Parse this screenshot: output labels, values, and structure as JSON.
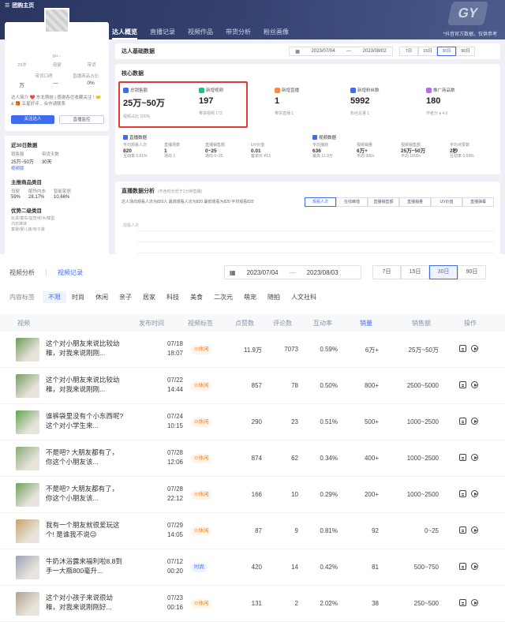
{
  "header": {
    "brand": "团购主页",
    "tabs": [
      "达人概览",
      "直播记录",
      "视频作品",
      "带货分析",
      "粉丝画像"
    ],
    "right_text": "*抖音官方数据，仅供参考",
    "deco": "GY"
  },
  "profile": {
    "name": "gu...",
    "stats_labels": [
      "29岁",
      "母婴",
      "带货"
    ],
    "meta_labels": [
      "带货口碑",
      "直播商品占比"
    ],
    "meta_values": [
      "万",
      "—",
      "0%"
    ],
    "desc": "达人简介 ❤️ 东北萌娃 | 感谢各位收藏关注 ! 🤝 & 🎁 五星好评... 合作请联系",
    "btn_follow": "关注达人",
    "btn_monitor": "直播监控"
  },
  "left30": {
    "title": "近30日数据",
    "labels": [
      "销售额",
      "带货天数"
    ],
    "values": [
      "25万~50万",
      "30天"
    ],
    "link": "视频版",
    "main_cat_title": "主推商品类目",
    "main_cats": [
      "母婴",
      "服饰内衣",
      "智能家居"
    ],
    "main_pcts": [
      "59%",
      "28.17%",
      "10.66%"
    ],
    "good_title": "优势二级类目",
    "good_lines": [
      "玩具/童车/益智/积木/模型",
      "内衣裤袜",
      "童装/婴儿装/亲子装"
    ]
  },
  "basic": {
    "title": "达人基础数据",
    "date_from": "2023/07/04",
    "date_to": "2023/08/02",
    "ranges": [
      "7日",
      "15日",
      "30日",
      "90日"
    ],
    "range_active": 2
  },
  "core": {
    "title": "核心数据",
    "kpis": [
      {
        "label": "总销售额",
        "value": "25万~50万",
        "sub": "视频占比 100%",
        "color": "#3e6cf0"
      },
      {
        "label": "新增视频",
        "value": "197",
        "sub": "带货视频 172",
        "color": "#1ebd8c"
      },
      {
        "label": "新增直播",
        "value": "1",
        "sub": "带货直播 1",
        "color": "#ff8a3d"
      },
      {
        "label": "新增粉丝数",
        "value": "5992",
        "sub": "粉丝总量 1",
        "color": "#3e6cf0"
      },
      {
        "label": "推广商品数",
        "value": "180",
        "sub": "作者分 ♦ 4.6",
        "color": "#b36bf0"
      }
    ],
    "live_title": "直播数据",
    "video_title": "视频数据",
    "live_minis": [
      {
        "l": "平均观看人次",
        "v": "820",
        "s": "互动率 0.61%"
      },
      {
        "l": "直播场数",
        "v": "1",
        "s": "场均 1"
      },
      {
        "l": "直播销售额",
        "v": "0~25",
        "s": "场均 0~25"
      },
      {
        "l": "UV价值",
        "v": "0.01",
        "s": "客单价 ¥13"
      }
    ],
    "video_minis": [
      {
        "l": "平均播放",
        "v": "636",
        "s": "最高 11.9万"
      },
      {
        "l": "视频销量",
        "v": "6万+",
        "s": "平均 300+"
      },
      {
        "l": "视频销售额",
        "v": "25万~50万",
        "s": "平均 1000+"
      },
      {
        "l": "平均点赞数",
        "v": "2秒",
        "s": "互动率 0.59%"
      }
    ]
  },
  "live": {
    "title": "直播数据分析",
    "subtitle": "(不含时长低于1分钟直播)",
    "summary": "达人场均观看人次为820人  最高观看人次为820  最低观看为820  平均观看820",
    "tabs": [
      "观看人次",
      "在线峰值",
      "直播销售额",
      "直播销量",
      "UV价值",
      "直播弹幕"
    ],
    "tab_active": 0,
    "y_label": "观看人次"
  },
  "video": {
    "tabs": [
      "视频分析",
      "视频记录"
    ],
    "tab_active": 1,
    "date_from": "2023/07/04",
    "date_sep": "—",
    "date_to": "2023/08/03",
    "ranges": [
      "7日",
      "15日",
      "30日",
      "90日"
    ],
    "range_active": 2,
    "cat_label": "内容标签",
    "cats": [
      "不限",
      "时尚",
      "休闲",
      "亲子",
      "居家",
      "科技",
      "美食",
      "二次元",
      "萌宠",
      "随拍",
      "人文社科"
    ],
    "cat_active": 0,
    "headers": [
      "视频",
      "发布时间",
      "视频标签",
      "点赞数",
      "评论数",
      "互动率",
      "销量",
      "销售额",
      "操作"
    ],
    "rows": [
      {
        "title": "这个对小朋友来说比较幼稚，对我来说刚刚...",
        "date": "07/18",
        "time": "18:07",
        "tag": "休闲",
        "tag_color": "orange",
        "likes": "11.9万",
        "comments": "7073",
        "rate": "0.59%",
        "sales": "6万+",
        "gmv": "25万~50万",
        "thumb": "#6e9a58"
      },
      {
        "title": "这个对小朋友来说比较幼稚，对我来说刚刚...",
        "date": "07/22",
        "time": "14:44",
        "tag": "休闲",
        "tag_color": "orange",
        "likes": "857",
        "comments": "78",
        "rate": "0.50%",
        "sales": "800+",
        "gmv": "2500~5000",
        "thumb": "#7a9d67"
      },
      {
        "title": "谁裤袋里没有个小东西呢? 这个对小学生来...",
        "date": "07/24",
        "time": "10:15",
        "tag": "休闲",
        "tag_color": "orange",
        "likes": "290",
        "comments": "23",
        "rate": "0.51%",
        "sales": "500+",
        "gmv": "1000~2500",
        "thumb": "#5fa450"
      },
      {
        "title": "不是吧? 大朋友都有了，你这个小朋友该...",
        "date": "07/28",
        "time": "12:06",
        "tag": "休闲",
        "tag_color": "orange",
        "likes": "874",
        "comments": "62",
        "rate": "0.34%",
        "sales": "400+",
        "gmv": "1000~2500",
        "thumb": "#8aab77"
      },
      {
        "title": "不是吧? 大朋友都有了，你这个小朋友该...",
        "date": "07/28",
        "time": "22:12",
        "tag": "休闲",
        "tag_color": "orange",
        "likes": "166",
        "comments": "10",
        "rate": "0.29%",
        "sales": "200+",
        "gmv": "1000~2500",
        "thumb": "#73a05d"
      },
      {
        "title": "我有一个朋友就很爱玩这个! 是谁我不说😉",
        "date": "07/29",
        "time": "14:05",
        "tag": "休闲",
        "tag_color": "orange",
        "likes": "87",
        "comments": "9",
        "rate": "0.81%",
        "sales": "92",
        "gmv": "0~25",
        "thumb": "#c9a36a"
      },
      {
        "title": "牛奶沐浴露来福利啦8.8到手一大瓶800毫升...",
        "date": "07/12",
        "time": "00:20",
        "tag": "时尚",
        "tag_color": "blue",
        "likes": "420",
        "comments": "14",
        "rate": "0.42%",
        "sales": "81",
        "gmv": "500~750",
        "thumb": "#9aa3b5"
      },
      {
        "title": "这个对小孩子来说很幼稚，对我来说刚刚好...",
        "date": "07/23",
        "time": "00:16",
        "tag": "休闲",
        "tag_color": "orange",
        "likes": "131",
        "comments": "2",
        "rate": "2.02%",
        "sales": "38",
        "gmv": "250~500",
        "thumb": "#b0a28c"
      }
    ]
  }
}
